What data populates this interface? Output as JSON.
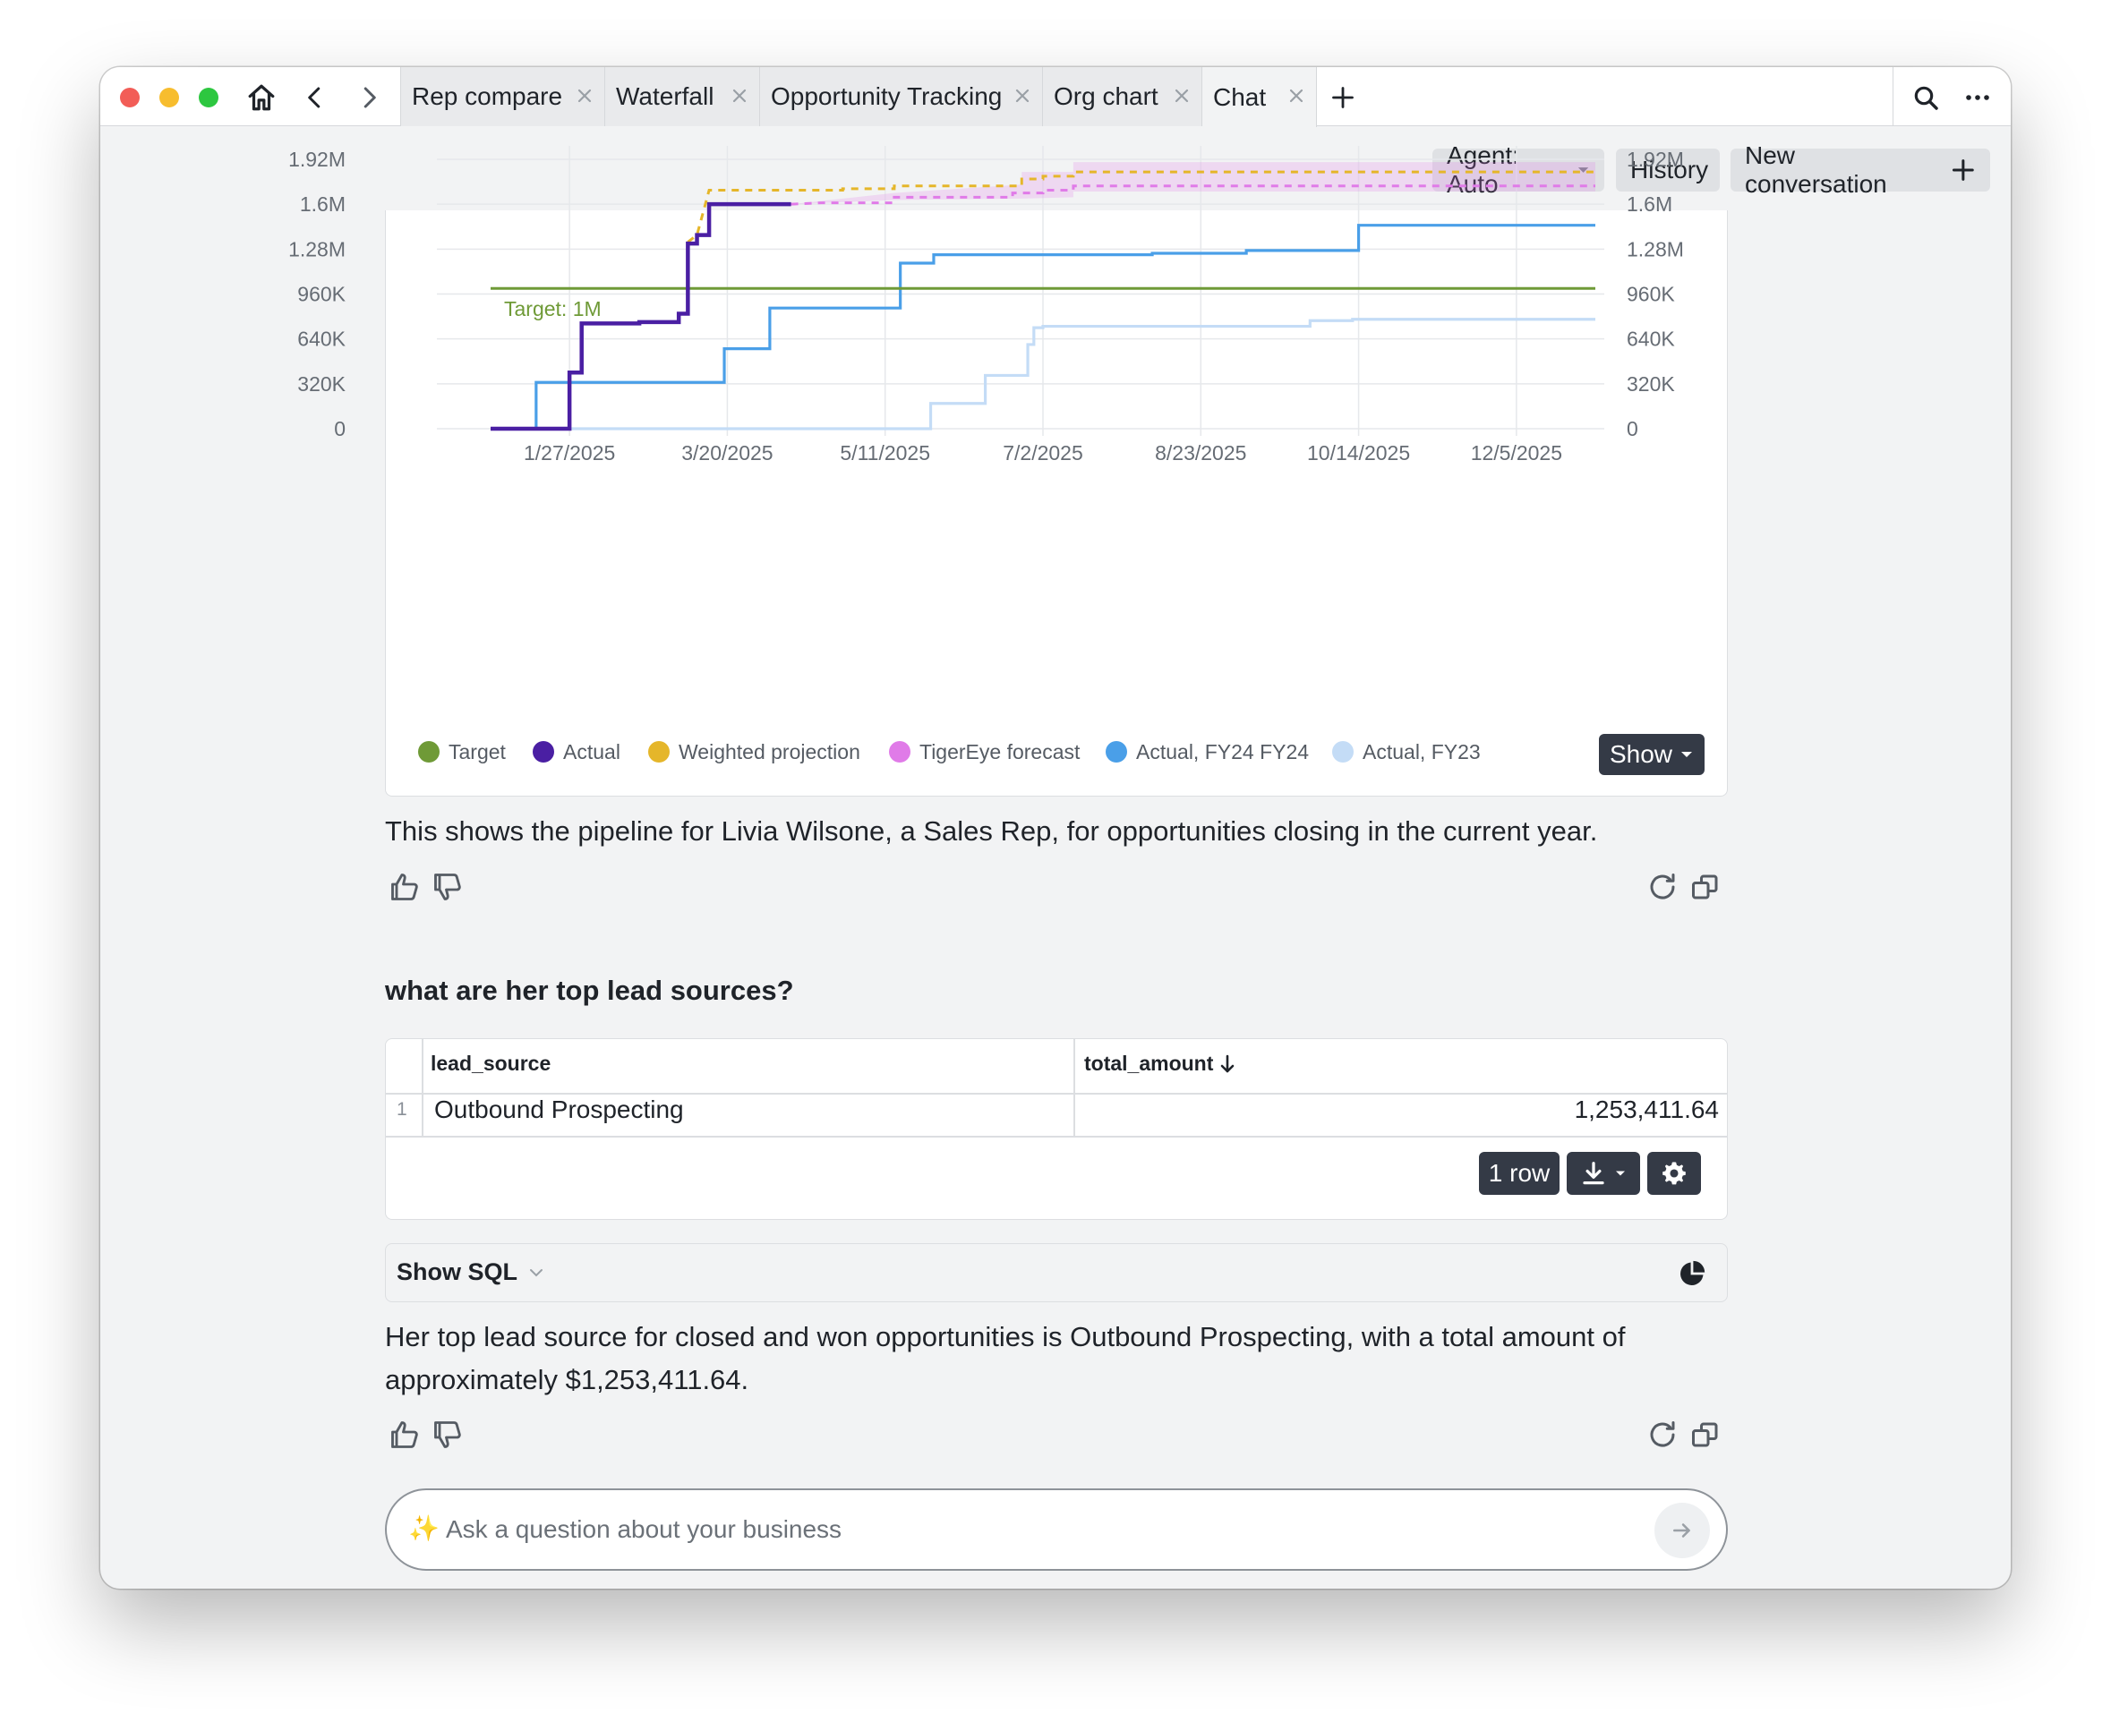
{
  "tabs": [
    {
      "label": "Rep compare"
    },
    {
      "label": "Waterfall"
    },
    {
      "label": "Opportunity Tracking"
    },
    {
      "label": "Org chart"
    },
    {
      "label": "Chat"
    }
  ],
  "header": {
    "agent_label": "Agent: Auto",
    "history_label": "History",
    "new_conversation_label": "New conversation"
  },
  "colors": {
    "target": "#6f9a37",
    "actual": "#4a1fa3",
    "weighted_projection": "#e5b62a",
    "tigereye_forecast": "#e07be8",
    "actual_fy24": "#4a9fe8",
    "actual_fy23": "#c4dcf6"
  },
  "chart_data": {
    "type": "line",
    "x_tick_labels": [
      "1/27/2025",
      "3/20/2025",
      "5/11/2025",
      "7/2/2025",
      "8/23/2025",
      "10/14/2025",
      "12/5/2025"
    ],
    "y_tick_labels": [
      "0",
      "320K",
      "640K",
      "960K",
      "1.28M",
      "1.6M",
      "1.92M"
    ],
    "ylim": [
      0,
      1920000
    ],
    "xlim": [
      "2025-01-01",
      "2025-12-31"
    ],
    "annotation": "Target: 1M",
    "legend_position": "bottom",
    "grid": true,
    "series": [
      {
        "name": "Target",
        "style": "solid",
        "points": [
          [
            "2025-01-01",
            1000000
          ],
          [
            "2025-12-31",
            1000000
          ]
        ]
      },
      {
        "name": "Actual",
        "style": "solid",
        "points": [
          [
            "2025-01-01",
            0
          ],
          [
            "2025-01-27",
            0
          ],
          [
            "2025-01-27",
            400000
          ],
          [
            "2025-01-31",
            400000
          ],
          [
            "2025-01-31",
            750000
          ],
          [
            "2025-02-19",
            750000
          ],
          [
            "2025-02-19",
            760000
          ],
          [
            "2025-03-04",
            760000
          ],
          [
            "2025-03-04",
            820000
          ],
          [
            "2025-03-07",
            820000
          ],
          [
            "2025-03-07",
            1320000
          ],
          [
            "2025-03-10",
            1320000
          ],
          [
            "2025-03-10",
            1380000
          ],
          [
            "2025-03-14",
            1380000
          ],
          [
            "2025-03-14",
            1600000
          ],
          [
            "2025-04-10",
            1600000
          ]
        ]
      },
      {
        "name": "Weighted projection",
        "style": "dashed",
        "points": [
          [
            "2025-03-07",
            1330000
          ],
          [
            "2025-03-10",
            1380000
          ],
          [
            "2025-03-14",
            1700000
          ],
          [
            "2025-04-27",
            1700000
          ],
          [
            "2025-04-27",
            1710000
          ],
          [
            "2025-05-14",
            1710000
          ],
          [
            "2025-05-14",
            1730000
          ],
          [
            "2025-06-25",
            1730000
          ],
          [
            "2025-06-25",
            1780000
          ],
          [
            "2025-07-02",
            1780000
          ],
          [
            "2025-07-02",
            1800000
          ],
          [
            "2025-07-12",
            1800000
          ],
          [
            "2025-07-12",
            1830000
          ],
          [
            "2025-12-31",
            1830000
          ]
        ]
      },
      {
        "name": "TigerEye forecast",
        "style": "dashed",
        "points": [
          [
            "2025-04-10",
            1600000
          ],
          [
            "2025-04-20",
            1610000
          ],
          [
            "2025-05-14",
            1610000
          ],
          [
            "2025-05-14",
            1650000
          ],
          [
            "2025-06-22",
            1650000
          ],
          [
            "2025-06-22",
            1680000
          ],
          [
            "2025-07-02",
            1680000
          ],
          [
            "2025-07-02",
            1700000
          ],
          [
            "2025-07-12",
            1700000
          ],
          [
            "2025-07-12",
            1730000
          ],
          [
            "2025-12-31",
            1730000
          ]
        ]
      },
      {
        "name": "Actual, FY24 FY24",
        "style": "solid",
        "points": [
          [
            "2025-01-16",
            0
          ],
          [
            "2025-01-16",
            330000
          ],
          [
            "2025-03-19",
            330000
          ],
          [
            "2025-03-19",
            570000
          ],
          [
            "2025-04-03",
            570000
          ],
          [
            "2025-04-03",
            860000
          ],
          [
            "2025-05-16",
            860000
          ],
          [
            "2025-05-16",
            1180000
          ],
          [
            "2025-05-27",
            1180000
          ],
          [
            "2025-05-27",
            1240000
          ],
          [
            "2025-08-07",
            1240000
          ],
          [
            "2025-08-07",
            1250000
          ],
          [
            "2025-08-07",
            1250000
          ],
          [
            "2025-09-07",
            1250000
          ],
          [
            "2025-09-07",
            1270000
          ],
          [
            "2025-10-14",
            1270000
          ],
          [
            "2025-10-14",
            1450000
          ],
          [
            "2025-12-31",
            1450000
          ]
        ]
      },
      {
        "name": "Actual, FY23",
        "style": "solid",
        "points": [
          [
            "2025-01-01",
            0
          ],
          [
            "2025-05-26",
            0
          ],
          [
            "2025-05-26",
            180000
          ],
          [
            "2025-06-13",
            180000
          ],
          [
            "2025-06-13",
            380000
          ],
          [
            "2025-06-27",
            380000
          ],
          [
            "2025-06-27",
            600000
          ],
          [
            "2025-06-29",
            600000
          ],
          [
            "2025-06-29",
            720000
          ],
          [
            "2025-07-02",
            720000
          ],
          [
            "2025-07-02",
            730000
          ],
          [
            "2025-09-28",
            730000
          ],
          [
            "2025-09-28",
            770000
          ],
          [
            "2025-10-12",
            770000
          ],
          [
            "2025-10-12",
            780000
          ],
          [
            "2025-12-31",
            780000
          ]
        ]
      }
    ],
    "band": {
      "name": "TigerEye forecast",
      "upper": [
        [
          "2025-04-10",
          1600000
        ],
        [
          "2025-05-14",
          1680000
        ],
        [
          "2025-06-25",
          1740000
        ],
        [
          "2025-06-25",
          1830000
        ],
        [
          "2025-07-12",
          1830000
        ],
        [
          "2025-07-12",
          1900000
        ],
        [
          "2025-12-31",
          1900000
        ]
      ],
      "lower": [
        [
          "2025-04-10",
          1600000
        ],
        [
          "2025-05-14",
          1630000
        ],
        [
          "2025-06-25",
          1640000
        ],
        [
          "2025-07-12",
          1650000
        ],
        [
          "2025-07-12",
          1690000
        ],
        [
          "2025-12-31",
          1690000
        ]
      ]
    }
  },
  "chart": {
    "show_label": "Show",
    "caption": "This shows the pipeline for Livia Wilsone, a Sales Rep, for opportunities closing in the current year."
  },
  "question": "what are her top lead sources?",
  "table": {
    "columns": [
      "lead_source",
      "total_amount"
    ],
    "rows": [
      {
        "index": "1",
        "lead_source": "Outbound Prospecting",
        "total_amount": "1,253,411.64"
      }
    ],
    "row_count_label": "1 row"
  },
  "sql": {
    "label": "Show SQL"
  },
  "answer": "Her top lead source for closed and won opportunities is Outbound Prospecting, with a total amount of approximately $1,253,411.64.",
  "input": {
    "placeholder": "Ask a question about your business"
  }
}
